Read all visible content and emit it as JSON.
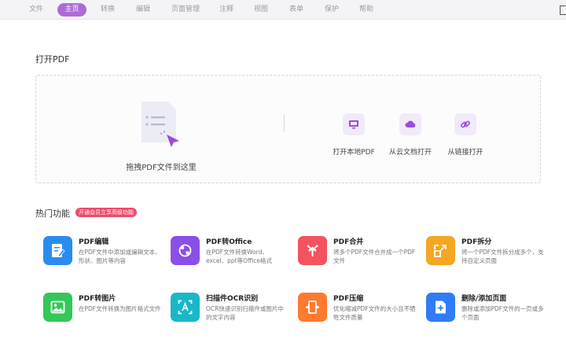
{
  "menu": [
    {
      "label": "文件",
      "active": false
    },
    {
      "label": "主页",
      "active": true
    },
    {
      "label": "转换",
      "active": false
    },
    {
      "label": "编辑",
      "active": false
    },
    {
      "label": "页面管理",
      "active": false
    },
    {
      "label": "注释",
      "active": false
    },
    {
      "label": "视图",
      "active": false
    },
    {
      "label": "表单",
      "active": false
    },
    {
      "label": "保护",
      "active": false
    },
    {
      "label": "帮助",
      "active": false
    }
  ],
  "open_pdf": {
    "title": "打开PDF",
    "drop_text": "拖拽PDF文件到这里",
    "options": [
      {
        "label": "打开本地PDF",
        "icon": "monitor-icon"
      },
      {
        "label": "从云文档打开",
        "icon": "cloud-icon"
      },
      {
        "label": "从链接打开",
        "icon": "link-icon"
      }
    ]
  },
  "hot": {
    "title": "热门功能",
    "badge": "开通会员立享高级功能",
    "features": [
      {
        "title": "PDF编辑",
        "desc": "在PDF文件中添加或编辑文本、形状、图片等内容",
        "icon": "edit-doc-icon",
        "color": "#2b8cf0"
      },
      {
        "title": "PDF转Office",
        "desc": "在PDF文件转换Word、excel、ppt等Office格式",
        "icon": "convert-icon",
        "color": "#8a4fe6"
      },
      {
        "title": "PDF合并",
        "desc": "将多个PDF文件合并成一个PDF文件",
        "icon": "merge-icon",
        "color": "#f4535f"
      },
      {
        "title": "PDF拆分",
        "desc": "将一个PDF文件拆分成多个，支持自定义页面",
        "icon": "split-icon",
        "color": "#f5a623"
      },
      {
        "title": "PDF转图片",
        "desc": "在PDF文件转换为图片格式文件",
        "icon": "image-icon",
        "color": "#34c759"
      },
      {
        "title": "扫描件OCR识别",
        "desc": "OCR快速识别扫描件或图片中的文字内容",
        "icon": "ocr-icon",
        "color": "#19b8c8"
      },
      {
        "title": "PDF压缩",
        "desc": "优化缩减PDF文件的大小且不牺牲文件质量",
        "icon": "compress-icon",
        "color": "#ff7a2e"
      },
      {
        "title": "删除/添加页面",
        "desc": "删除或添加PDF文件的一页或多个页面",
        "icon": "add-page-icon",
        "color": "#2f7cf6"
      }
    ]
  }
}
